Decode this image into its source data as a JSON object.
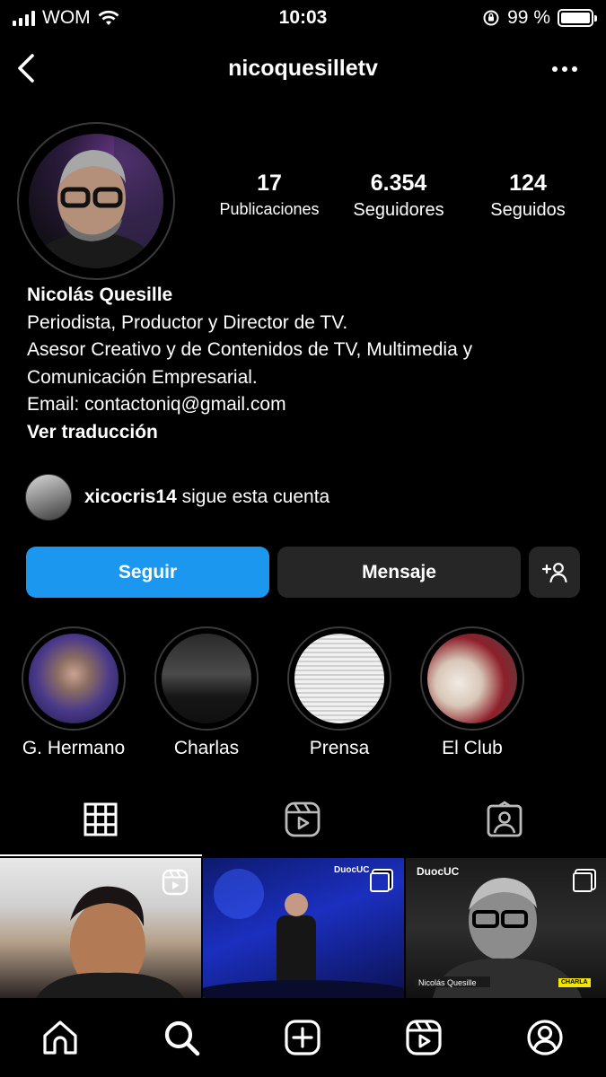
{
  "status": {
    "carrier": "WOM",
    "time": "10:03",
    "battery_percent": "99 %",
    "battery_level": 0.99
  },
  "header": {
    "handle": "nicoquesilletv"
  },
  "stats": [
    {
      "value": "17",
      "label": "Publicaciones"
    },
    {
      "value": "6.354",
      "label": "Seguidores"
    },
    {
      "value": "124",
      "label": "Seguidos"
    }
  ],
  "bio": {
    "name": "Nicolás Quesille",
    "lines": [
      "Periodista, Productor y Director de TV.",
      "Asesor Creativo y de Contenidos de TV, Multimedia y",
      "Comunicación Empresarial.",
      "Email: contactoniq@gmail.com"
    ],
    "translate": "Ver traducción"
  },
  "followed_by": {
    "user": "xicocris14",
    "text": "sigue esta cuenta"
  },
  "actions": {
    "follow": "Seguir",
    "message": "Mensaje"
  },
  "highlights": [
    {
      "label": "G. Hermano"
    },
    {
      "label": "Charlas"
    },
    {
      "label": "Prensa"
    },
    {
      "label": "El Club"
    }
  ],
  "posts": [
    {
      "overlay_text": ""
    },
    {
      "overlay_text": "DuocUC"
    },
    {
      "overlay_text": "DuocUC",
      "caption": "Nicolás Quesille",
      "tag": "CHARLA"
    }
  ],
  "colors": {
    "accent": "#1c97f0",
    "button_dark": "#262626",
    "background": "#000000"
  },
  "icons": [
    "back-icon",
    "more-icon",
    "add-person-icon",
    "grid-icon",
    "reels-icon",
    "tagged-icon",
    "home-icon",
    "search-icon",
    "create-icon",
    "reels-nav-icon",
    "profile-icon"
  ]
}
